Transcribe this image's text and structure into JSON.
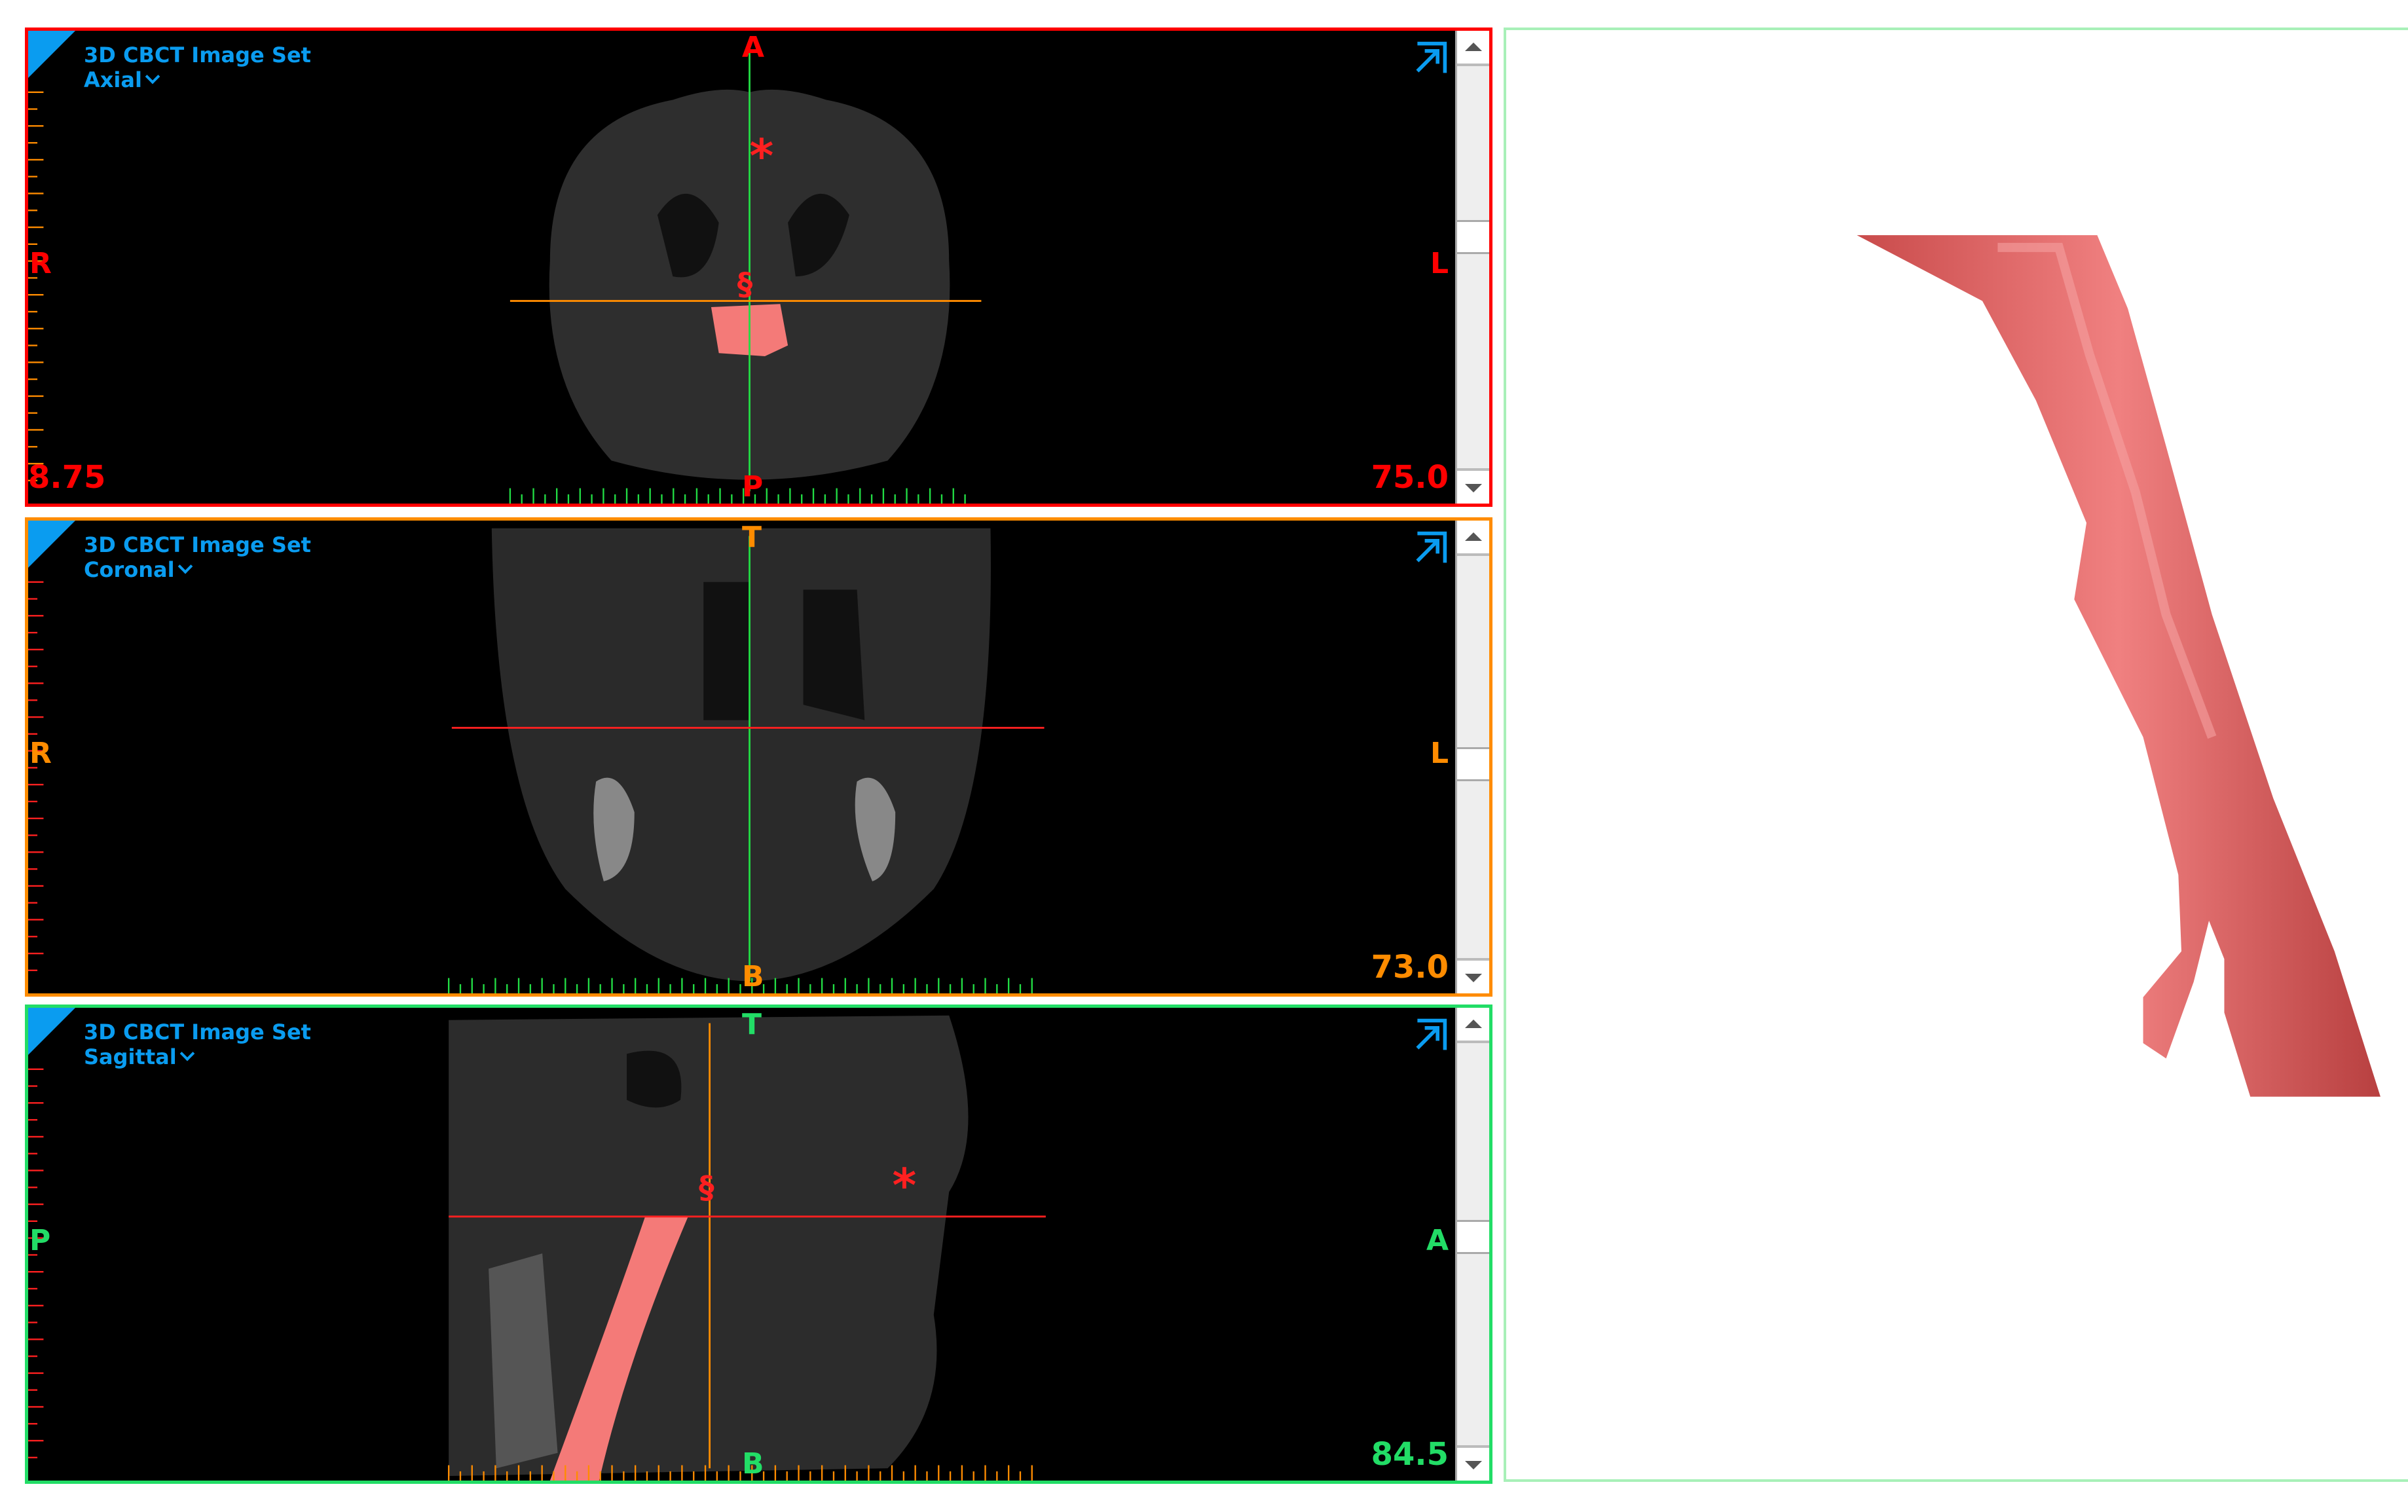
{
  "panels": [
    {
      "id": "axial",
      "image_set": "3D CBCT Image Set",
      "view": "Axial",
      "border_color": "#ff0000",
      "letter_color": "#ff0000",
      "orientation": {
        "top": "A",
        "bottom": "P",
        "left": "R",
        "right": "L"
      },
      "value_left": "8.75",
      "value_right": "75.0",
      "value_color": "#ff0000",
      "scroll_fraction": 0.42,
      "markers": [
        "*",
        "§"
      ]
    },
    {
      "id": "coronal",
      "image_set": "3D CBCT Image Set",
      "view": "Coronal",
      "border_color": "#ff8c00",
      "letter_color": "#ff8c00",
      "orientation": {
        "top": "T",
        "bottom": "B",
        "left": "R",
        "right": "L"
      },
      "value_right": "73.0",
      "value_color": "#ff8c00",
      "scroll_fraction": 0.52,
      "markers": []
    },
    {
      "id": "sagittal",
      "image_set": "3D CBCT Image Set",
      "view": "Sagittal",
      "border_color": "#22dd66",
      "letter_color": "#22dd66",
      "orientation": {
        "top": "T",
        "bottom": "B",
        "left": "P",
        "right": "A"
      },
      "value_right": "84.5",
      "value_color": "#22dd66",
      "scroll_fraction": 0.48,
      "markers": [
        "§",
        "*"
      ]
    }
  ],
  "colors": {
    "accent": "#0a9cf0",
    "segmentation": "#f47a78",
    "model": "#e06060"
  },
  "icons": {
    "expand": "expand-arrow-icon",
    "view_menu": "chevron-down-icon"
  }
}
